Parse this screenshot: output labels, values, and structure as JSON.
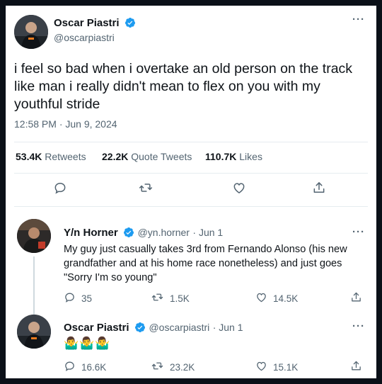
{
  "main_tweet": {
    "author_name": "Oscar Piastri",
    "author_handle": "@oscarpiastri",
    "text_lines": [
      "i feel so bad when i overtake an old person on the track",
      "like man i really didn't mean to flex on you with my",
      "youthful stride"
    ],
    "timestamp": "12:58 PM · Jun 9, 2024",
    "stats": {
      "retweets_count": "53.4K",
      "retweets_label": "Retweets",
      "quote_count": "22.2K",
      "quote_label": "Quote Tweets",
      "likes_count": "110.7K",
      "likes_label": "Likes"
    },
    "actions": [
      "reply-icon",
      "retweet-icon",
      "like-icon",
      "share-icon"
    ]
  },
  "replies": [
    {
      "author_name": "Y/n Horner",
      "author_handle": "@yn.horner",
      "date": "· Jun 1",
      "text_lines": [
        "My guy just casually takes 3rd from Fernando Alonso (his new",
        "grandfather and at his home race nonetheless) and just goes",
        "\"Sorry I'm so young\""
      ],
      "reply_count": "35",
      "retweet_count": "1.5K",
      "like_count": "14.5K"
    },
    {
      "author_name": "Oscar Piastri",
      "author_handle": "@oscarpiastri",
      "date": "· Jun 1",
      "text": "🤷‍♂️🤷‍♂️🤷‍♂️",
      "reply_count": "16.6K",
      "retweet_count": "23.2K",
      "like_count": "15.1K"
    }
  ],
  "colors": {
    "accent": "#1d9bf0",
    "muted": "#536471",
    "text": "#0f1419",
    "border": "#e6ecf0"
  }
}
